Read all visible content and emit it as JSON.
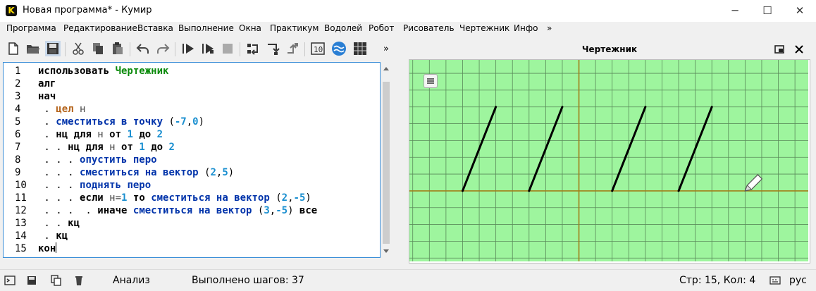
{
  "window": {
    "title": "Новая программа* - Кумир",
    "app_icon_letter": "K",
    "controls": {
      "minimize": "─",
      "maximize": "☐",
      "close": "✕"
    }
  },
  "menu": {
    "items": [
      "Программа",
      "Редактирование",
      "Вставка",
      "Выполнение",
      "Окна",
      "Практикум",
      "Водолей",
      "Робот",
      "Рисователь",
      "Чертежник",
      "Инфо",
      "»"
    ]
  },
  "toolbar": {
    "icons": [
      "new-file-icon",
      "open-folder-icon",
      "save-icon",
      "cut-icon",
      "copy-icon",
      "paste-icon",
      "undo-icon",
      "redo-icon",
      "run-icon",
      "run-step-icon",
      "stop-icon",
      "step-over-icon",
      "step-into-icon",
      "step-out-icon",
      "numbers-window-icon",
      "water-icon",
      "grid-icon"
    ],
    "overflow_label": "»"
  },
  "editor": {
    "lines": [
      {
        "n": "1",
        "tokens": [
          [
            "kw",
            "использовать "
          ],
          [
            "mod",
            "Чертежник"
          ]
        ]
      },
      {
        "n": "2",
        "tokens": [
          [
            "kw",
            "алг"
          ]
        ]
      },
      {
        "n": "3",
        "tokens": [
          [
            "kw",
            "нач"
          ]
        ]
      },
      {
        "n": "4",
        "tokens": [
          [
            "pun",
            " . "
          ],
          [
            "typ",
            "цел"
          ],
          [
            "id",
            " н"
          ]
        ]
      },
      {
        "n": "5",
        "tokens": [
          [
            "pun",
            " . "
          ],
          [
            "cmd",
            "сместиться в точку"
          ],
          [
            "pun",
            " ("
          ],
          [
            "num",
            "-7"
          ],
          [
            "pun",
            ","
          ],
          [
            "num",
            "0"
          ],
          [
            "pun",
            ")"
          ]
        ]
      },
      {
        "n": "6",
        "tokens": [
          [
            "pun",
            " . "
          ],
          [
            "kw",
            "нц для"
          ],
          [
            "id",
            " н "
          ],
          [
            "kw",
            "от"
          ],
          [
            "pun",
            " "
          ],
          [
            "num",
            "1"
          ],
          [
            "pun",
            " "
          ],
          [
            "kw",
            "до"
          ],
          [
            "pun",
            " "
          ],
          [
            "num",
            "2"
          ]
        ]
      },
      {
        "n": "7",
        "tokens": [
          [
            "pun",
            " . . "
          ],
          [
            "kw",
            "нц для"
          ],
          [
            "id",
            " н "
          ],
          [
            "kw",
            "от"
          ],
          [
            "pun",
            " "
          ],
          [
            "num",
            "1"
          ],
          [
            "pun",
            " "
          ],
          [
            "kw",
            "до"
          ],
          [
            "pun",
            " "
          ],
          [
            "num",
            "2"
          ]
        ]
      },
      {
        "n": "8",
        "tokens": [
          [
            "pun",
            " . . . "
          ],
          [
            "cmd",
            "опустить перо"
          ]
        ]
      },
      {
        "n": "9",
        "tokens": [
          [
            "pun",
            " . . . "
          ],
          [
            "cmd",
            "сместиться на вектор"
          ],
          [
            "pun",
            " ("
          ],
          [
            "num",
            "2"
          ],
          [
            "pun",
            ","
          ],
          [
            "num",
            "5"
          ],
          [
            "pun",
            ")"
          ]
        ]
      },
      {
        "n": "10",
        "tokens": [
          [
            "pun",
            " . . . "
          ],
          [
            "cmd",
            "поднять перо"
          ]
        ]
      },
      {
        "n": "11",
        "tokens": [
          [
            "pun",
            " . . . "
          ],
          [
            "kw",
            "если"
          ],
          [
            "id",
            " н="
          ],
          [
            "num",
            "1"
          ],
          [
            "pun",
            " "
          ],
          [
            "kw",
            "то"
          ],
          [
            "pun",
            " "
          ],
          [
            "cmd",
            "сместиться на вектор"
          ],
          [
            "pun",
            " ("
          ],
          [
            "num",
            "2"
          ],
          [
            "pun",
            ","
          ],
          [
            "num",
            "-5"
          ],
          [
            "pun",
            ")"
          ]
        ]
      },
      {
        "n": "12",
        "tokens": [
          [
            "pun",
            " . . .  . "
          ],
          [
            "kw",
            "иначе"
          ],
          [
            "pun",
            " "
          ],
          [
            "cmd",
            "сместиться на вектор"
          ],
          [
            "pun",
            " ("
          ],
          [
            "num",
            "3"
          ],
          [
            "pun",
            ","
          ],
          [
            "num",
            "-5"
          ],
          [
            "pun",
            ") "
          ],
          [
            "kw",
            "все"
          ]
        ]
      },
      {
        "n": "13",
        "tokens": [
          [
            "pun",
            " . . "
          ],
          [
            "kw",
            "кц"
          ]
        ]
      },
      {
        "n": "14",
        "tokens": [
          [
            "pun",
            " . "
          ],
          [
            "kw",
            "кц"
          ]
        ]
      },
      {
        "n": "15",
        "tokens": [
          [
            "kw",
            "кон"
          ]
        ]
      }
    ]
  },
  "drawer": {
    "title": "Чертежник",
    "colors": {
      "background": "#9ef59e",
      "grid": "#5a8a5a",
      "axis": "#a0801a",
      "pen": "#000000"
    },
    "segments": [
      {
        "from": [
          -7,
          0
        ],
        "to": [
          -5,
          5
        ]
      },
      {
        "from": [
          -3,
          0
        ],
        "to": [
          -1,
          5
        ]
      },
      {
        "from": [
          2,
          0
        ],
        "to": [
          4,
          5
        ]
      },
      {
        "from": [
          6,
          0
        ],
        "to": [
          8,
          5
        ]
      }
    ],
    "view": {
      "x_min": -10.2,
      "x_max": 13.8,
      "y_min": -4.2,
      "y_max": 7.8
    }
  },
  "status": {
    "analysis": "Анализ",
    "steps": "Выполнено шагов: 37",
    "position": "Стр: 15, Кол: 4",
    "lang": "рус"
  }
}
